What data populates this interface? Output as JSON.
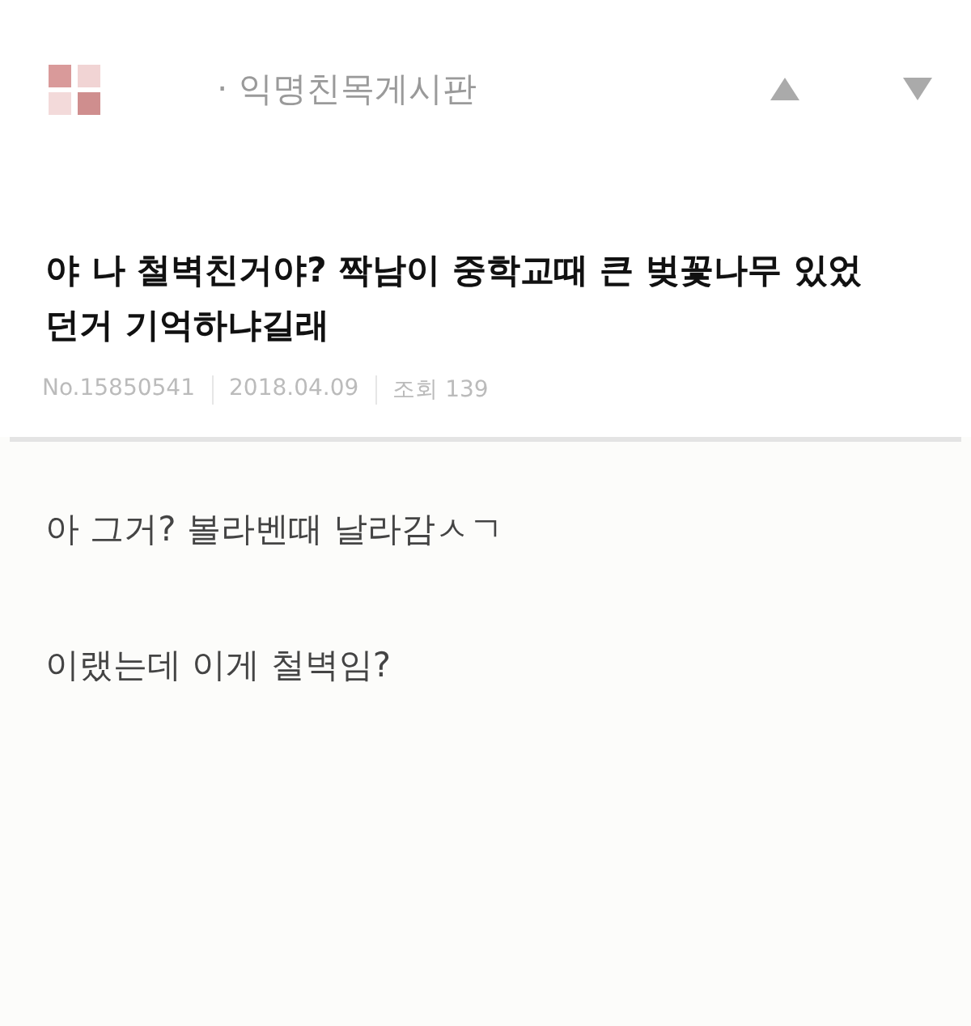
{
  "board": {
    "name": "· 익명친목게시판"
  },
  "post": {
    "title": "야 나 철벽친거야? 짝남이 중학교때 큰 벚꽃나무 있었던거 기억하냐길래",
    "meta": [
      "No.15850541",
      "2018.04.09",
      "조회 139"
    ],
    "body": [
      "아 그거? 볼라벤때 날라감ㅅㄱ",
      "이랬는데 이게 철벽임?"
    ]
  }
}
